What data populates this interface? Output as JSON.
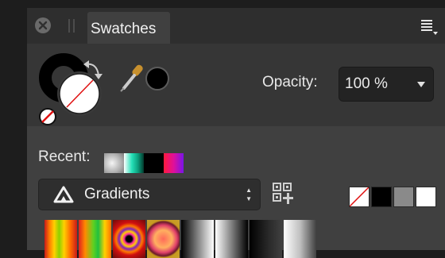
{
  "panel": {
    "tab_title": "Swatches",
    "opacity_label": "Opacity:",
    "opacity_value": "100 %",
    "recent_label": "Recent:",
    "category_select": "Gradients"
  },
  "icons": [
    "close-icon",
    "panel-menu-icon",
    "swap-colors-icon",
    "eyedropper-icon",
    "no-fill-icon",
    "affinity-logo-icon",
    "add-swatch-grid-icon",
    "stepper-arrows-icon"
  ],
  "colors": {
    "fill_color": "#000000",
    "stroke_color": "none",
    "picked_color": "#000000"
  },
  "recent_swatches": [
    "gray-gradient",
    "teal-gradient",
    "black",
    "red-purple-gradient"
  ],
  "document_swatches": [
    "none",
    "#000000",
    "#8a8a8a",
    "#ffffff"
  ],
  "gradient_swatches": [
    "rainbow-linear",
    "spectrum-linear",
    "rainbow-radial",
    "sunset-radial",
    "black-white-linear",
    "white-black-linear",
    "black-fade-linear",
    "white-fade-linear"
  ]
}
